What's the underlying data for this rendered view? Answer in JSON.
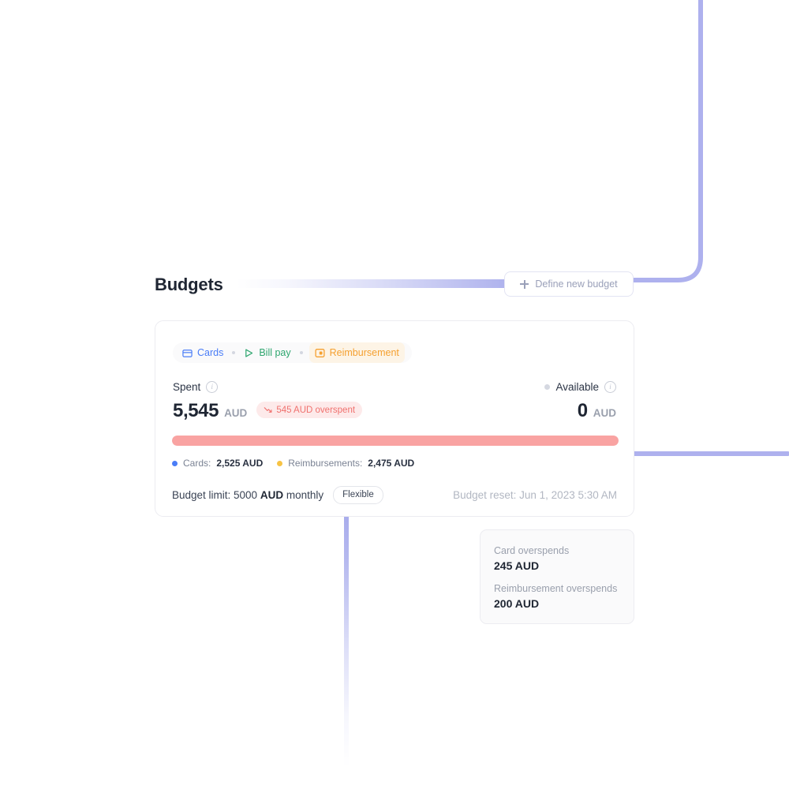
{
  "header": {
    "title": "Budgets",
    "define_button": {
      "label": "Define new budget",
      "icon": "plus-icon"
    }
  },
  "budget_card": {
    "chips": [
      {
        "label": "Cards",
        "icon": "credit-card-icon",
        "color": "#4a7df7"
      },
      {
        "label": "Bill pay",
        "icon": "send-icon",
        "color": "#2ea66f"
      },
      {
        "label": "Reimbursement",
        "icon": "receipt-card-icon",
        "color": "#f5a030"
      }
    ],
    "spent": {
      "label": "Spent",
      "amount": "5,545",
      "currency": "AUD",
      "overspent_badge": {
        "text": "545 AUD overspent",
        "icon": "trending-up-icon",
        "color": "#f0716e",
        "background": "#fdeaea"
      }
    },
    "available": {
      "label": "Available",
      "amount": "0",
      "currency": "AUD"
    },
    "progress": {
      "fill_percent": 100,
      "fill_color": "#f9a3a2",
      "track_color": "#f2f3f5"
    },
    "legend": [
      {
        "label": "Cards:",
        "value": "2,525 AUD",
        "color": "#4a7df7"
      },
      {
        "label": "Reimbursements:",
        "value": "2,475 AUD",
        "color": "#f7c344"
      }
    ],
    "footer": {
      "limit_prefix": "Budget limit: 5000 ",
      "limit_currency": "AUD",
      "limit_suffix": " monthly",
      "flexible_badge": "Flexible",
      "reset_text": "Budget reset: Jun 1, 2023 5:30 AM"
    }
  },
  "overspend_tooltip": {
    "rows": [
      {
        "label": "Card overspends",
        "value": "245 AUD"
      },
      {
        "label": "Reimbursement overspends",
        "value": "200 AUD"
      }
    ]
  },
  "connectors": {
    "color": "#aeb1ee"
  }
}
